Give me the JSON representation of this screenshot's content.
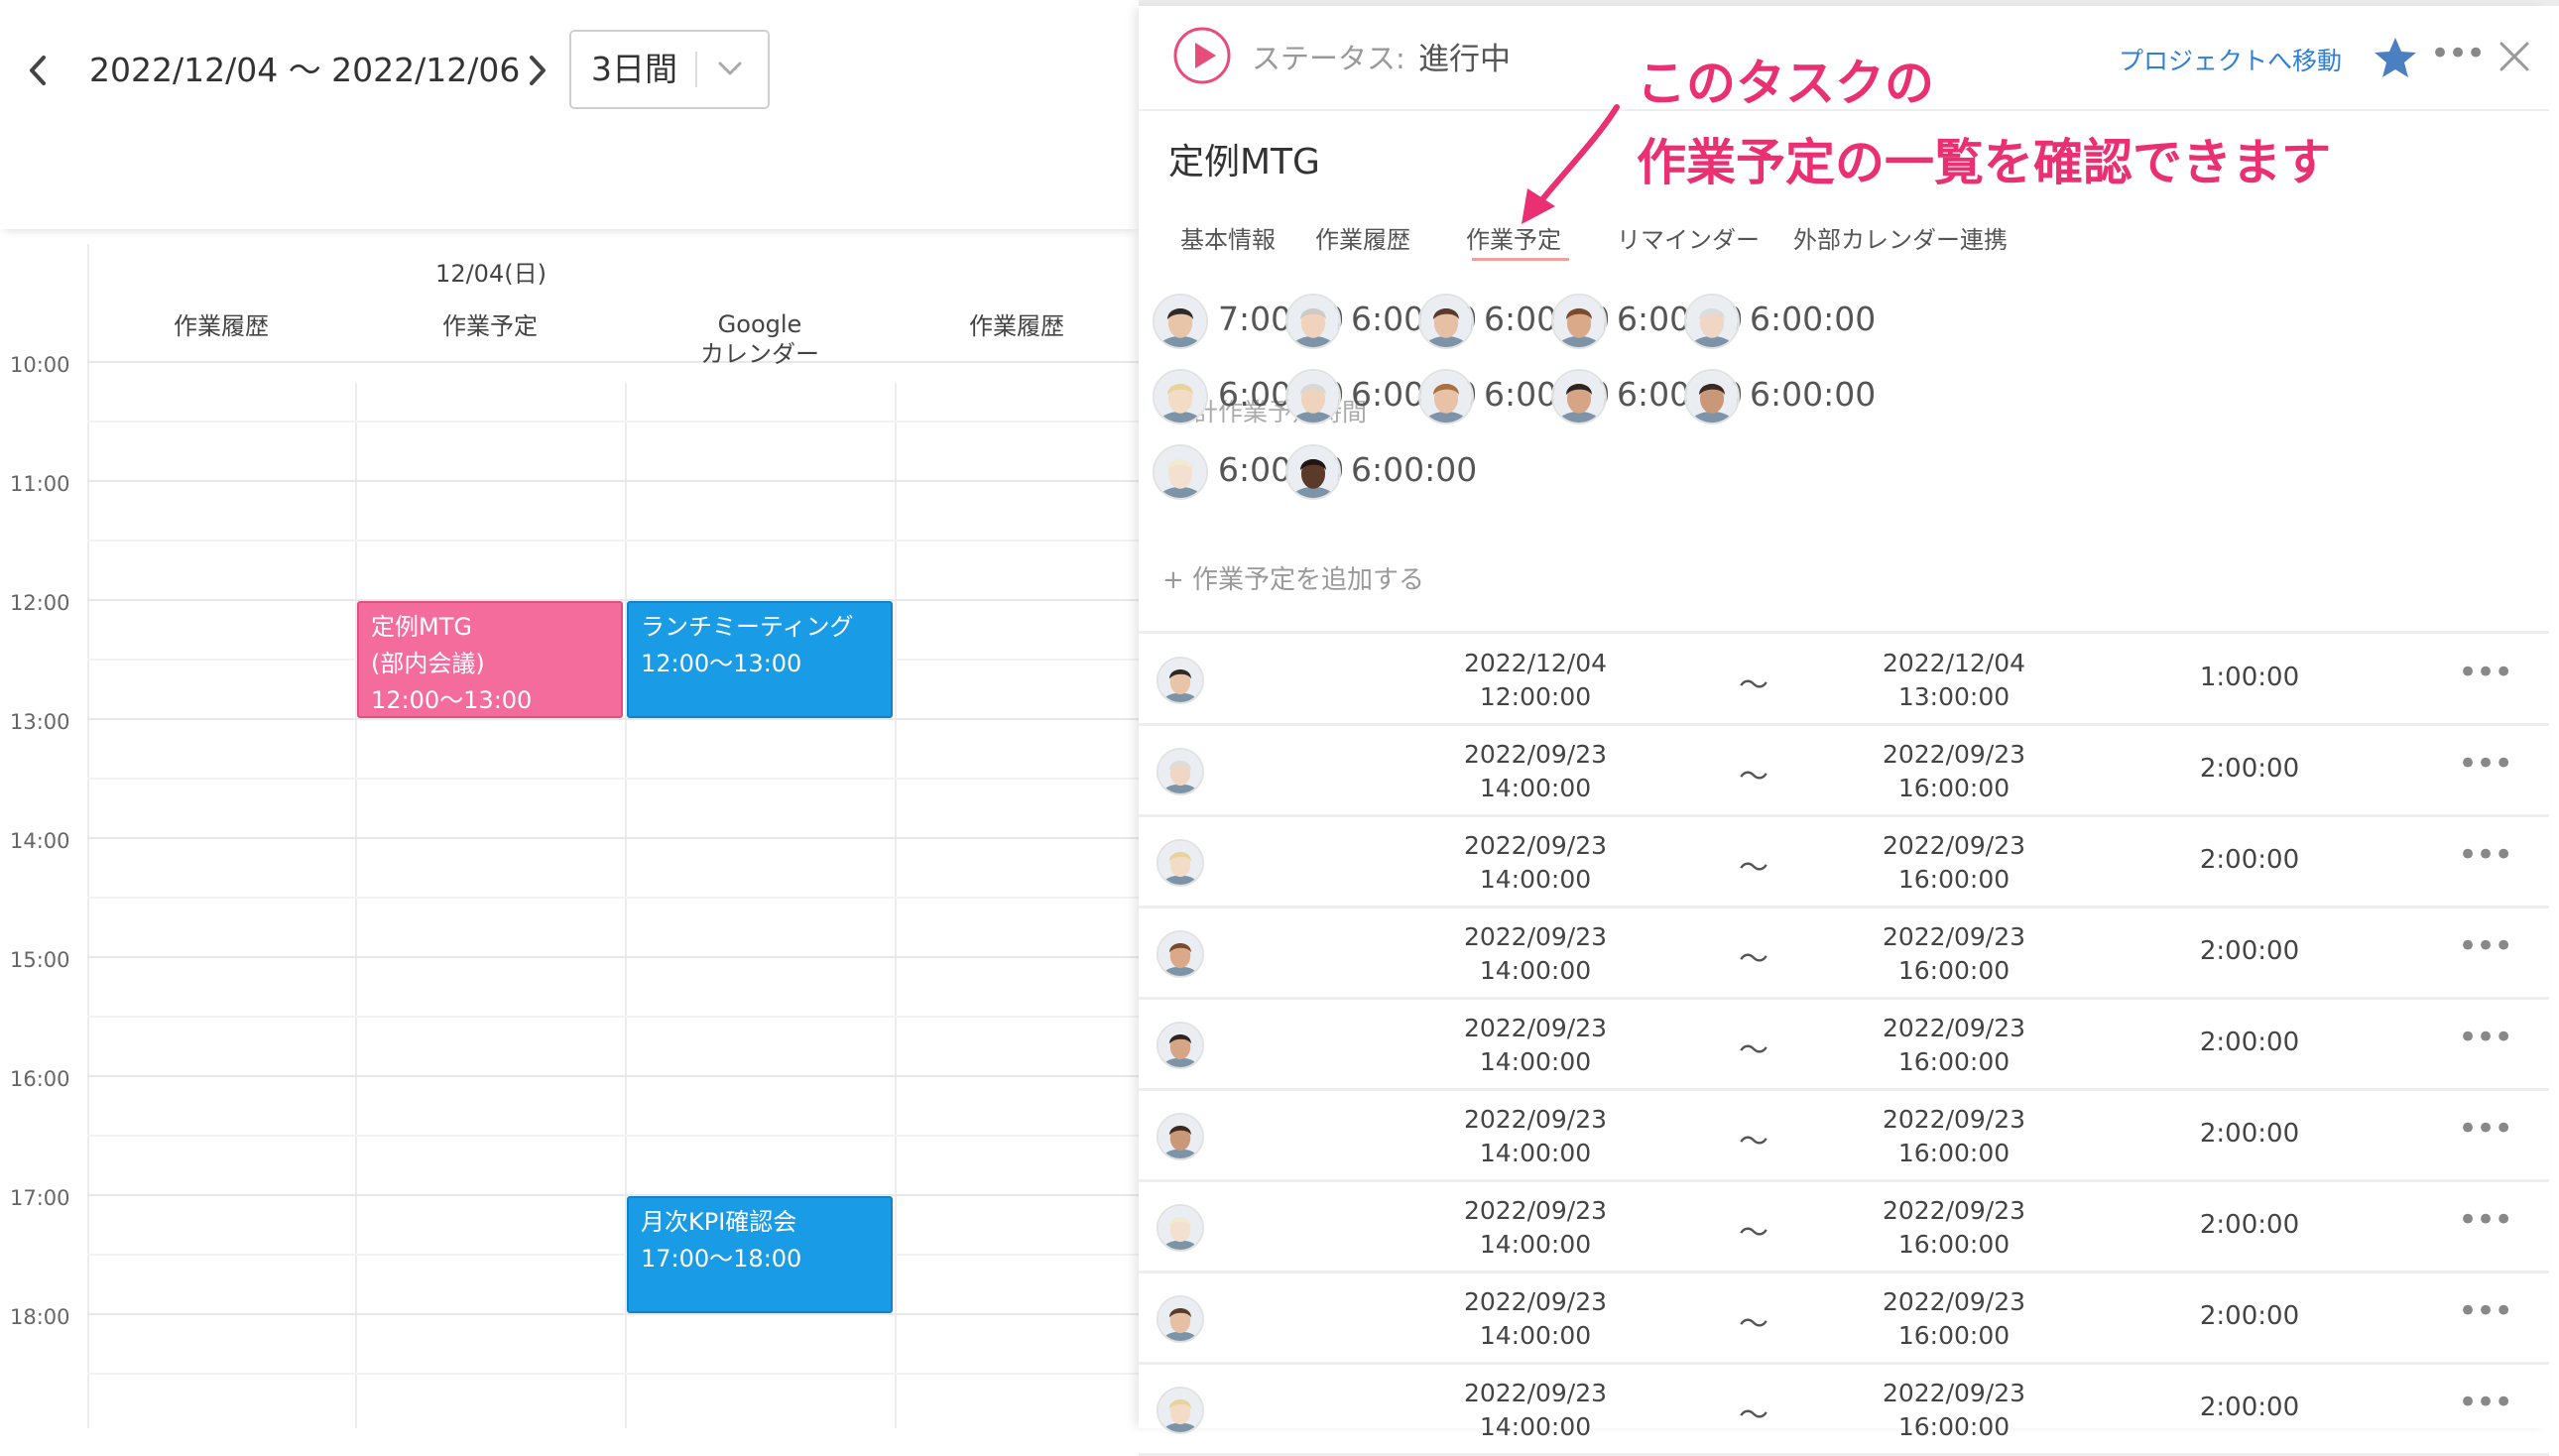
{
  "toolbar": {
    "date_range": "2022/12/04 〜 2022/12/06",
    "view": "3日間"
  },
  "calendar": {
    "day_label": "12/04(日)",
    "columns": [
      "作業履歴",
      "作業予定",
      "Google\nカレンダー",
      "作業履歴"
    ],
    "times": [
      "10:00",
      "11:00",
      "12:00",
      "13:00",
      "14:00",
      "15:00",
      "16:00",
      "17:00",
      "18:00"
    ],
    "events": [
      {
        "lines": [
          "定例MTG",
          "(部内会議)",
          "12:00〜13:00"
        ],
        "color": "#f46c9c"
      },
      {
        "lines": [
          "ランチミーティング",
          "12:00〜13:00"
        ],
        "color": "#1a9be6"
      },
      {
        "lines": [
          "月次KPI確認会",
          "17:00〜18:00"
        ],
        "color": "#1a9be6"
      }
    ]
  },
  "panel": {
    "status_label": "ステータス:",
    "status_value": "進行中",
    "project_link": "プロジェクトへ移動",
    "task_title": "定例MTG",
    "tabs": [
      "基本情報",
      "作業履歴",
      "作業予定",
      "リマインダー",
      "外部カレンダー連携"
    ],
    "active_tab": "作業予定",
    "sum_label": "合計作業予定時間",
    "plans": [
      "7:00:00",
      "6:00:00",
      "6:00:00",
      "6:00:00",
      "6:00:00",
      "6:00:00",
      "6:00:00",
      "6:00:00",
      "6:00:00",
      "6:00:00",
      "6:00:00",
      "6:00:00"
    ],
    "add_plan": "+ 作業予定を追加する",
    "rows": [
      {
        "start_date": "2022/12/04",
        "start_time": "12:00:00",
        "end_date": "2022/12/04",
        "end_time": "13:00:00",
        "duration": "1:00:00"
      },
      {
        "start_date": "2022/09/23",
        "start_time": "14:00:00",
        "end_date": "2022/09/23",
        "end_time": "16:00:00",
        "duration": "2:00:00"
      },
      {
        "start_date": "2022/09/23",
        "start_time": "14:00:00",
        "end_date": "2022/09/23",
        "end_time": "16:00:00",
        "duration": "2:00:00"
      },
      {
        "start_date": "2022/09/23",
        "start_time": "14:00:00",
        "end_date": "2022/09/23",
        "end_time": "16:00:00",
        "duration": "2:00:00"
      },
      {
        "start_date": "2022/09/23",
        "start_time": "14:00:00",
        "end_date": "2022/09/23",
        "end_time": "16:00:00",
        "duration": "2:00:00"
      },
      {
        "start_date": "2022/09/23",
        "start_time": "14:00:00",
        "end_date": "2022/09/23",
        "end_time": "16:00:00",
        "duration": "2:00:00"
      },
      {
        "start_date": "2022/09/23",
        "start_time": "14:00:00",
        "end_date": "2022/09/23",
        "end_time": "16:00:00",
        "duration": "2:00:00"
      },
      {
        "start_date": "2022/09/23",
        "start_time": "14:00:00",
        "end_date": "2022/09/23",
        "end_time": "16:00:00",
        "duration": "2:00:00"
      },
      {
        "start_date": "2022/09/23",
        "start_time": "14:00:00",
        "end_date": "2022/09/23",
        "end_time": "16:00:00",
        "duration": "2:00:00"
      }
    ],
    "separator": "〜"
  },
  "annotation": {
    "line1": "このタスクの",
    "line2": "作業予定の一覧を確認できます"
  },
  "colors": {
    "accent_pink": "#ea2f72",
    "link_blue": "#2f7fd6",
    "star": "#4a7fc1"
  }
}
